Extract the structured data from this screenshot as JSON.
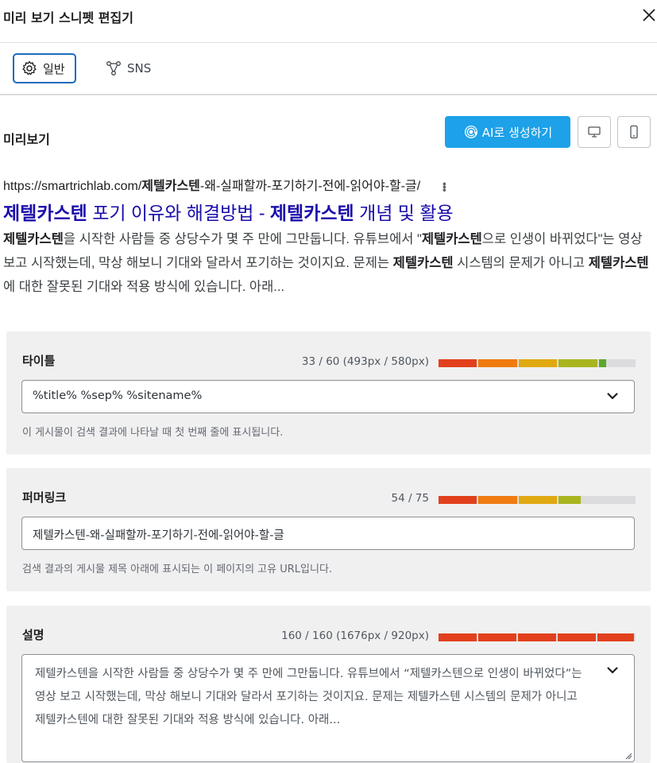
{
  "header": {
    "title": "미리 보기 스니펫 편집기"
  },
  "tabs": [
    {
      "label": "일반",
      "icon": "gear-icon",
      "active": true
    },
    {
      "label": "SNS",
      "icon": "share-nodes-icon",
      "active": false
    }
  ],
  "preview": {
    "label": "미리보기",
    "ai_button": "AI로 생성하기",
    "url_prefix": "https://smartrichlab.com/",
    "url_bold": "제텔카스텐",
    "url_rest": "-왜-실패할까-포기하기-전에-읽어야-할-글/",
    "title_bold_1": "제텔카스텐",
    "title_mid": " 포기 이유와 해결방법 - ",
    "title_bold_2": "제텔카스텐",
    "title_end": " 개념 및 활용",
    "desc_b1": "제텔카스텐",
    "desc_t1": "을 시작한 사람들 중 상당수가 몇 주 만에 그만둡니다. 유튜브에서 \"",
    "desc_b2": "제텔카스텐",
    "desc_t2": "으로 인생이 바뀌었다\"는 영상 보고 시작했는데, 막상 해보니 기대와 달라서 포기하는 것이지요. 문제는 ",
    "desc_b3": "제텔카스텐",
    "desc_t3": " 시스템의 문제가 아니고 ",
    "desc_b4": "제텔카스텐",
    "desc_t4": "에 대한 잘못된 기대와 적용 방식에 있습니다. 아래..."
  },
  "title_card": {
    "label": "타이틀",
    "count": "33 / 60 (493px / 580px)",
    "meter_fraction": 0.85,
    "value": "%title% %sep% %sitename%",
    "help": "이 게시물이 검색 결과에 나타날 때 첫 번째 줄에 표시됩니다."
  },
  "permalink_card": {
    "label": "퍼머링크",
    "count": "54 / 75",
    "meter_fraction": 0.72,
    "value": "제텔카스텐-왜-실패할까-포기하기-전에-읽어야-할-글",
    "help": "검색 결과의 게시물 제목 아래에 표시되는 이 페이지의 고유 URL입니다."
  },
  "description_card": {
    "label": "설명",
    "count": "160 / 160 (1676px / 920px)",
    "meter_fraction": 1.0,
    "value": "제텔카스텐을 시작한 사람들 중 상당수가 몇 주 만에 그만둡니다. 유튜브에서 “제텔카스텐으로 인생이 바뀌었다”는 영상 보고 시작했는데, 막상 해보니 기대와 달라서 포기하는 것이지요. 문제는 제텔카스텐 시스템의 문제가 아니고 제텔카스텐에 대한 잘못된 기대와 적용 방식에 있습니다. 아래..."
  },
  "colors": {
    "accent": "#1da1e9",
    "tab_border": "#1e6bb8",
    "link_title": "#1a0dab",
    "meter_red": "#e2401c",
    "meter_orange": "#f07b10",
    "meter_yellow": "#e0a912",
    "meter_olive": "#a9b51f",
    "meter_green": "#5aa82c"
  }
}
